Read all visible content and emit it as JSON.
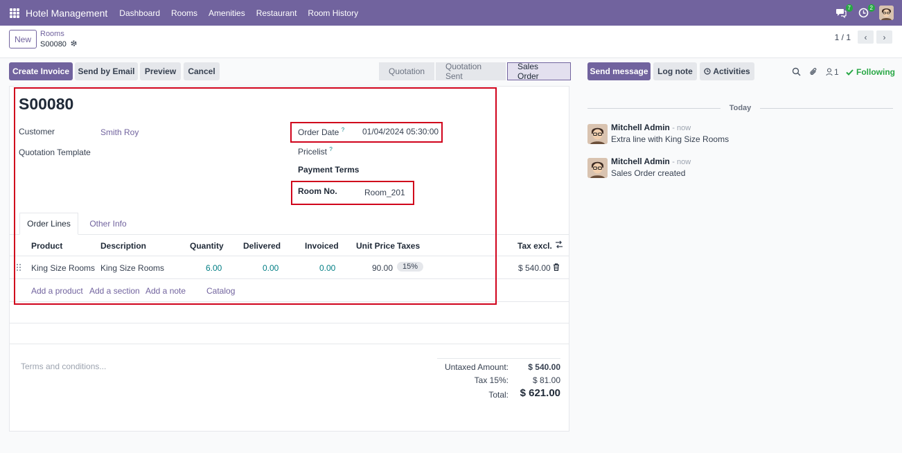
{
  "navbar": {
    "brand": "Hotel Management",
    "menu": [
      "Dashboard",
      "Rooms",
      "Amenities",
      "Restaurant",
      "Room History"
    ],
    "messages_badge": "7",
    "activities_badge": "2",
    "color": "#71639e"
  },
  "control": {
    "new_label": "New",
    "breadcrumb": "Rooms",
    "record": "S00080",
    "pager": "1 / 1"
  },
  "statusbar": {
    "create_invoice": "Create Invoice",
    "send_by_email": "Send by Email",
    "preview": "Preview",
    "cancel": "Cancel",
    "stages": [
      "Quotation",
      "Quotation Sent",
      "Sales Order"
    ],
    "active_stage": "Sales Order"
  },
  "form": {
    "title": "S00080",
    "customer_label": "Customer",
    "customer_value": "Smith Roy",
    "quotation_template_label": "Quotation Template",
    "order_date_label": "Order Date",
    "order_date_value": "01/04/2024 05:30:00",
    "pricelist_label": "Pricelist",
    "help_mark": "?",
    "payment_terms_label": "Payment Terms",
    "room_no_label": "Room No.",
    "room_no_value": "Room_201"
  },
  "tabs": [
    "Order Lines",
    "Other Info"
  ],
  "order_lines": {
    "headers": [
      "Product",
      "Description",
      "Quantity",
      "Delivered",
      "Invoiced",
      "Unit Price",
      "Taxes",
      "Tax excl."
    ],
    "rows": [
      {
        "product": "King Size Rooms",
        "description": "King Size Rooms",
        "quantity": "6.00",
        "delivered": "0.00",
        "invoiced": "0.00",
        "unit_price": "90.00",
        "taxes": "15%",
        "subtotal": "$ 540.00"
      }
    ],
    "add_links": [
      "Add a product",
      "Add a section",
      "Add a note",
      "Catalog"
    ]
  },
  "terms_placeholder": "Terms and conditions...",
  "totals": {
    "untaxed_label": "Untaxed Amount:",
    "untaxed_value": "$ 540.00",
    "tax_label": "Tax 15%:",
    "tax_value": "$ 81.00",
    "total_label": "Total:",
    "total_value": "$ 621.00"
  },
  "chatter": {
    "send_message": "Send message",
    "log_note": "Log note",
    "activities": "Activities",
    "followers_count": "1",
    "following": "Following",
    "date_separator": "Today",
    "messages": [
      {
        "author": "Mitchell Admin",
        "time": "- now",
        "body": "Extra line with King Size Rooms"
      },
      {
        "author": "Mitchell Admin",
        "time": "- now",
        "body": "Sales Order created"
      }
    ]
  }
}
